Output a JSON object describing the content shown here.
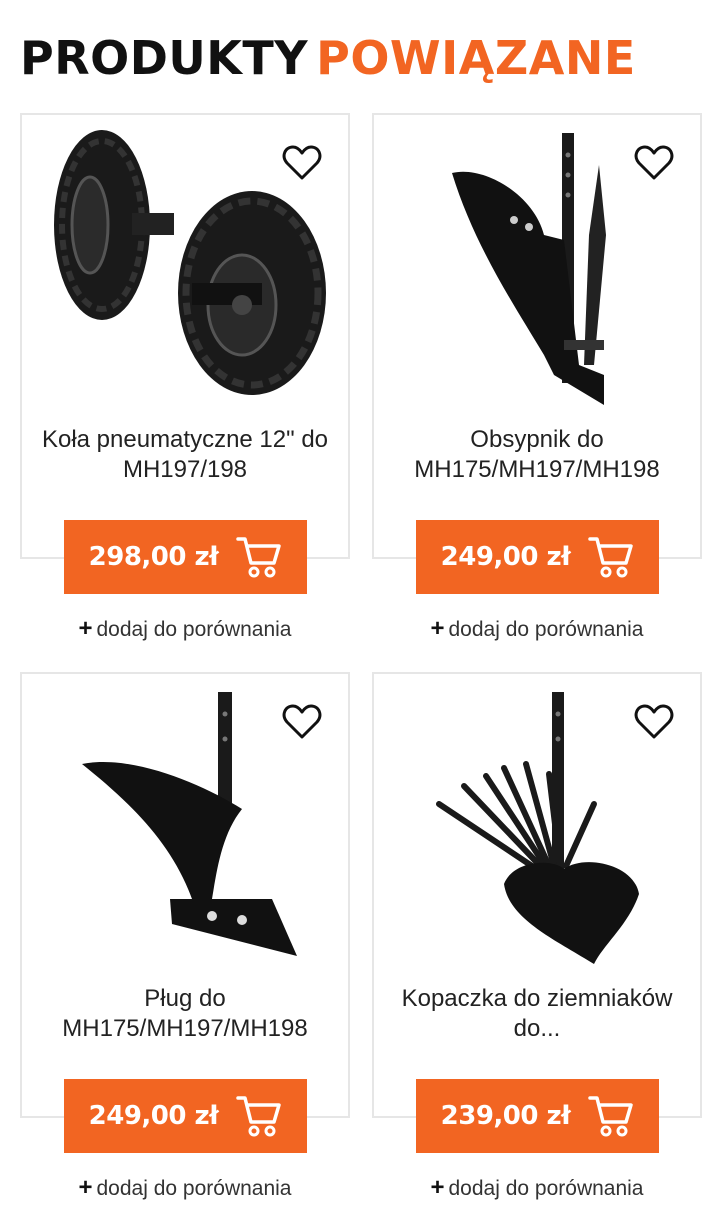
{
  "section": {
    "title_part1": "PRODUKTY",
    "title_part2": "POWIĄZANE"
  },
  "colors": {
    "accent": "#f26522",
    "text": "#222222",
    "border": "#e6e6e6"
  },
  "products": [
    {
      "name": "Koła pneumatyczne 12\" do MH197/198",
      "price": "298,00 zł",
      "compare": "dodaj do porównania",
      "image": "pneumatic-wheels"
    },
    {
      "name": "Obsypnik do MH175/MH197/MH198",
      "price": "249,00 zł",
      "compare": "dodaj do porównania",
      "image": "hiller"
    },
    {
      "name": "Pług do MH175/MH197/MH198",
      "price": "249,00 zł",
      "compare": "dodaj do porównania",
      "image": "plough"
    },
    {
      "name": "Kopaczka do ziemniaków do...",
      "price": "239,00 zł",
      "compare": "dodaj do porównania",
      "image": "potato-digger"
    }
  ],
  "icons": {
    "wishlist": "heart-outline-icon",
    "cart": "shopping-cart-icon",
    "compare": "plus-icon"
  }
}
